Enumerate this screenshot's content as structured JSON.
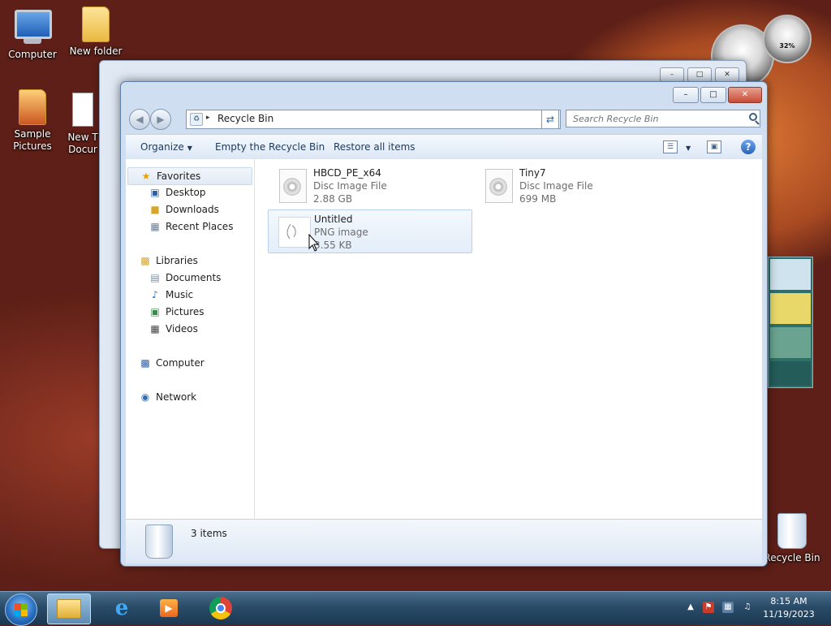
{
  "desktop": {
    "icons": [
      {
        "label": "Computer",
        "icon": "computer-icon"
      },
      {
        "label": "New folder",
        "icon": "folder-icon"
      },
      {
        "label": "Sample Pictures",
        "icon": "folder-pictures-icon"
      },
      {
        "label": "New T",
        "label2": "Docur",
        "icon": "text-document-icon"
      },
      {
        "label": "Recycle Bin",
        "icon": "recycle-bin-icon"
      }
    ],
    "gadget_meter_value": "32%"
  },
  "window": {
    "buttons": {
      "minimize": "–",
      "maximize": "□",
      "close": "✕"
    },
    "address": {
      "crumb": "Recycle Bin",
      "separator": "▸"
    },
    "search_placeholder": "Search Recycle Bin",
    "commands": {
      "organize": "Organize",
      "empty": "Empty the Recycle Bin",
      "restore": "Restore all items"
    },
    "nav": {
      "favorites": "Favorites",
      "favorites_items": [
        "Desktop",
        "Downloads",
        "Recent Places"
      ],
      "libraries": "Libraries",
      "libraries_items": [
        "Documents",
        "Music",
        "Pictures",
        "Videos"
      ],
      "computer": "Computer",
      "network": "Network"
    },
    "files": [
      {
        "name": "HBCD_PE_x64",
        "type": "Disc Image File",
        "size": "2.88 GB"
      },
      {
        "name": "Tiny7",
        "type": "Disc Image File",
        "size": "699 MB"
      },
      {
        "name": "Untitled",
        "type": "PNG image",
        "size": "3.55 KB"
      }
    ],
    "status": {
      "count": "3 items"
    }
  },
  "taskbar": {
    "clock_time": "8:15 AM",
    "clock_date": "11/19/2023"
  },
  "colors": {
    "accent": "#2c62b8",
    "taskbar": "#2a4c69"
  }
}
